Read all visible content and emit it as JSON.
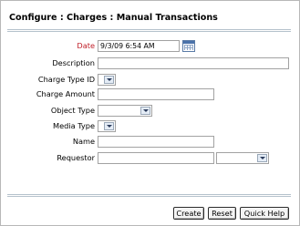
{
  "breadcrumb": {
    "title": "Configure : Charges : Manual Transactions"
  },
  "form": {
    "date": {
      "label": "Date",
      "value": "9/3/09 6:54 AM",
      "required": true
    },
    "description": {
      "label": "Description",
      "value": ""
    },
    "charge_type_id": {
      "label": "Charge Type ID",
      "value": ""
    },
    "charge_amount": {
      "label": "Charge Amount",
      "value": ""
    },
    "object_type": {
      "label": "Object Type",
      "value": ""
    },
    "media_type": {
      "label": "Media Type",
      "value": ""
    },
    "name": {
      "label": "Name",
      "value": ""
    },
    "requestor": {
      "label": "Requestor",
      "value": "",
      "select_value": ""
    }
  },
  "actions": {
    "create": "Create",
    "reset": "Reset",
    "quick_help": "Quick Help"
  },
  "colors": {
    "required_label": "#c0202a",
    "rule": "#b5c2cc",
    "calendar_icon": "#4a72aa"
  },
  "icons": {
    "calendar": "calendar-icon",
    "dropdown": "chevron-down-icon"
  }
}
